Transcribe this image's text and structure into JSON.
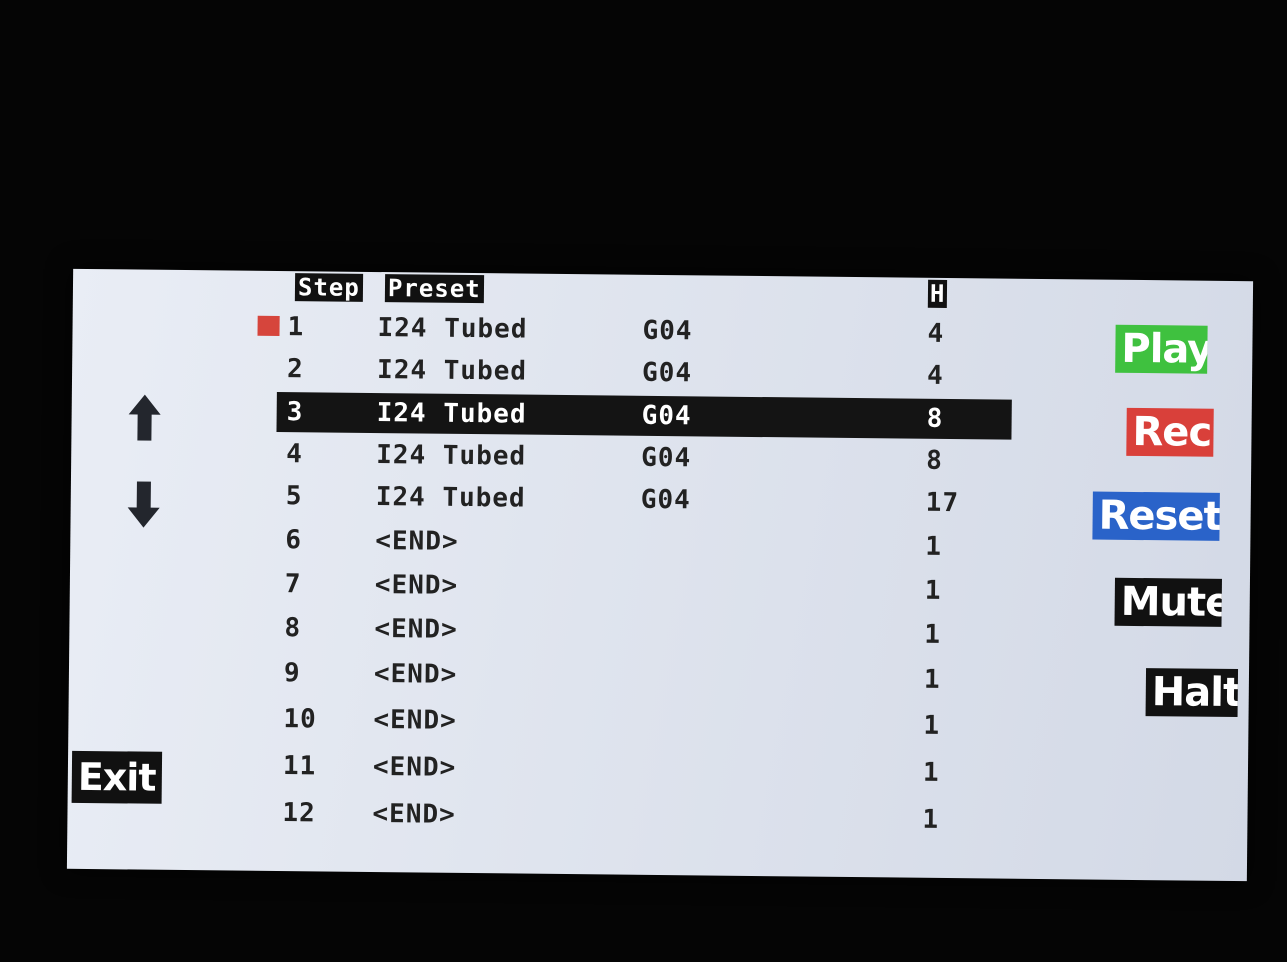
{
  "table": {
    "headers": {
      "step": "Step",
      "preset": "Preset",
      "repeat": "H"
    },
    "rows": [
      {
        "step": "1",
        "preset": "I24 Tubed",
        "bank": "G04",
        "repeat": "4",
        "playing": true
      },
      {
        "step": "2",
        "preset": "I24 Tubed",
        "bank": "G04",
        "repeat": "4"
      },
      {
        "step": "3",
        "preset": "I24 Tubed",
        "bank": "G04",
        "repeat": "8",
        "selected": true
      },
      {
        "step": "4",
        "preset": "I24 Tubed",
        "bank": "G04",
        "repeat": "8"
      },
      {
        "step": "5",
        "preset": "I24 Tubed",
        "bank": "G04",
        "repeat": "17"
      },
      {
        "step": "6",
        "preset": "<END>",
        "bank": "",
        "repeat": "1"
      },
      {
        "step": "7",
        "preset": "<END>",
        "bank": "",
        "repeat": "1"
      },
      {
        "step": "8",
        "preset": "<END>",
        "bank": "",
        "repeat": "1"
      },
      {
        "step": "9",
        "preset": "<END>",
        "bank": "",
        "repeat": "1"
      },
      {
        "step": "10",
        "preset": "<END>",
        "bank": "",
        "repeat": "1"
      },
      {
        "step": "11",
        "preset": "<END>",
        "bank": "",
        "repeat": "1"
      },
      {
        "step": "12",
        "preset": "<END>",
        "bank": "",
        "repeat": "1"
      }
    ]
  },
  "buttons": {
    "play": "Play",
    "rec": "Rec",
    "reset": "Reset",
    "mute": "Mute",
    "halt": "Halt",
    "exit": "Exit"
  },
  "icons": {
    "scroll_up": "arrow-up-icon",
    "scroll_down": "arrow-down-icon",
    "play_marker": "play-position-marker"
  },
  "colors": {
    "play": "#3fc13f",
    "rec": "#d9403a",
    "reset": "#2a63c9",
    "mute": "#111111",
    "halt": "#111111",
    "marker": "#d6453c",
    "selected_row": "#141414"
  }
}
